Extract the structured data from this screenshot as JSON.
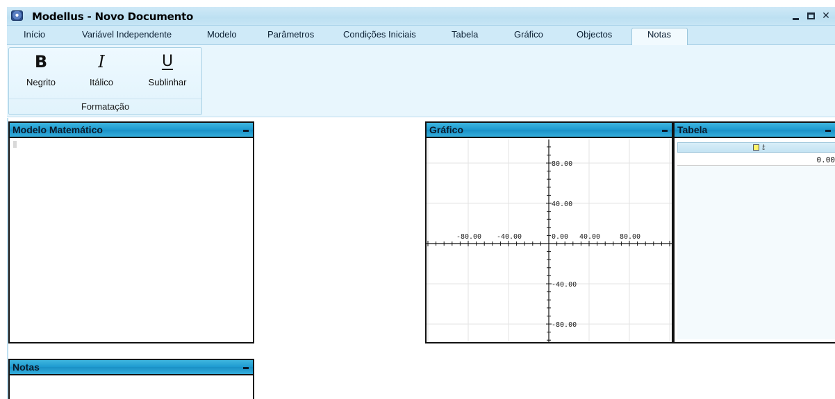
{
  "window": {
    "title": "Modellus - Novo Documento",
    "controls": [
      "minimize",
      "maximize",
      "close"
    ]
  },
  "menu": {
    "tabs": [
      {
        "label": "Início"
      },
      {
        "label": "Variável Independente"
      },
      {
        "label": "Modelo"
      },
      {
        "label": "Parâmetros"
      },
      {
        "label": "Condições Iniciais"
      },
      {
        "label": "Tabela"
      },
      {
        "label": "Gráfico"
      },
      {
        "label": "Objectos"
      },
      {
        "label": "Notas",
        "active": true
      }
    ]
  },
  "ribbon": {
    "groups": [
      {
        "label": "Formatação",
        "buttons": [
          {
            "glyph": "B",
            "label": "Negrito",
            "icon": "bold-icon"
          },
          {
            "glyph": "I",
            "label": "Itálico",
            "icon": "italic-icon"
          },
          {
            "glyph": "U",
            "label": "Sublinhar",
            "icon": "underline-icon"
          }
        ]
      }
    ]
  },
  "panels": {
    "modelo": {
      "title": "Modelo Matemático"
    },
    "grafico": {
      "title": "Gráfico",
      "x_ticks": [
        "-80.00",
        "-40.00",
        "0.00",
        "40.00",
        "80.00"
      ],
      "y_ticks": [
        "80.00",
        "40.00",
        "-40.00",
        "-80.00"
      ]
    },
    "tabela": {
      "title": "Tabela",
      "column": "t",
      "value": "0.00"
    },
    "notas": {
      "title": "Notas"
    }
  },
  "colors": {
    "panel_header": "#1d9ad0",
    "ribbon_bg": "#e8f6fd",
    "titlebar_bg": "#bde0f2"
  }
}
